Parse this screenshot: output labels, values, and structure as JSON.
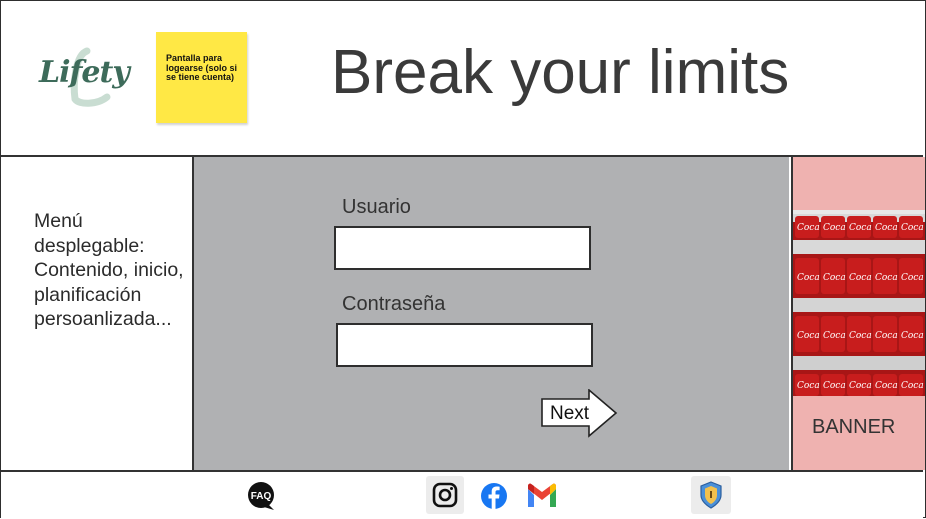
{
  "header": {
    "logo_text": "Lifety",
    "sticky_note": "Pantalla para logearse (solo si se tiene cuenta)",
    "title": "Break your limits"
  },
  "menu": {
    "text": "Menú desplegable: Contenido, inicio, planificación persoanlizada..."
  },
  "form": {
    "user_label": "Usuario",
    "user_value": "",
    "password_label": "Contraseña",
    "password_value": "",
    "next_label": "Next"
  },
  "banner": {
    "label": "BANNER",
    "image_subject": "coca-cola-bottles",
    "brand_text": "Coca-Cola"
  },
  "footer": {
    "icons": [
      "faq-icon",
      "instagram-icon",
      "facebook-icon",
      "gmail-icon",
      "shield-icon"
    ],
    "faq_text": "FAQ"
  },
  "colors": {
    "form_bg": "#b0b1b3",
    "banner_bg": "#efb2b0",
    "sticky_bg": "#ffe845",
    "logo_green": "#3d6b5a",
    "facebook_blue": "#1877f2"
  }
}
